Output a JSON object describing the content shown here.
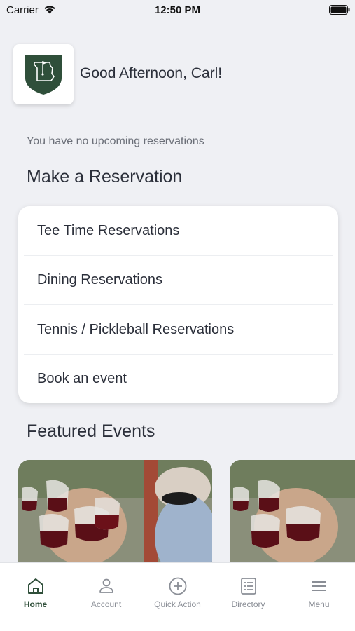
{
  "status_bar": {
    "carrier": "Carrier",
    "time": "12:50 PM"
  },
  "header": {
    "greeting": "Good Afternoon, Carl!"
  },
  "upcoming": {
    "message": "You have no upcoming reservations"
  },
  "reservations": {
    "title": "Make a Reservation",
    "items": [
      {
        "label": "Tee Time Reservations"
      },
      {
        "label": "Dining Reservations"
      },
      {
        "label": "Tennis / Pickleball Reservations"
      },
      {
        "label": "Book an event"
      }
    ]
  },
  "featured": {
    "title": "Featured Events"
  },
  "tab_bar": {
    "tabs": [
      {
        "label": "Home",
        "icon": "home-icon",
        "active": true
      },
      {
        "label": "Account",
        "icon": "user-icon",
        "active": false
      },
      {
        "label": "Quick Action",
        "icon": "plus-circle-icon",
        "active": false
      },
      {
        "label": "Directory",
        "icon": "list-icon",
        "active": false
      },
      {
        "label": "Menu",
        "icon": "hamburger-menu-icon",
        "active": false
      }
    ]
  },
  "colors": {
    "brand_green": "#2f4f3a",
    "background": "#eff0f4"
  }
}
